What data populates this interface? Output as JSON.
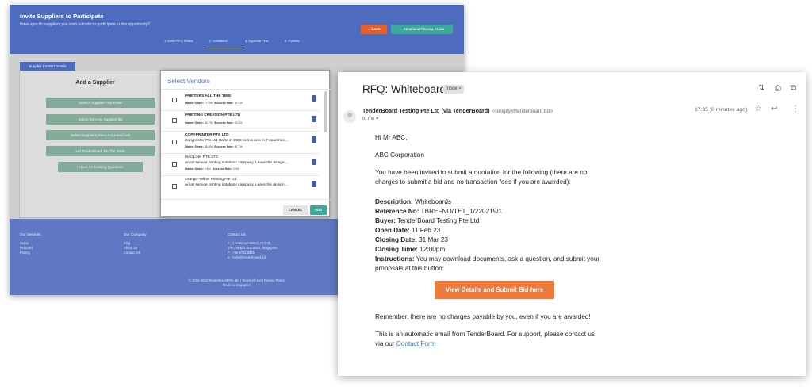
{
  "app": {
    "title": "Invite Suppliers to Participate",
    "subtitle": "Have specific suppliers you wish to invite to participate in this opportunity?",
    "back_label": "← BACK",
    "review_label": "→ REVIEW APPROVAL FLOW",
    "steps": [
      "1. Enter RFQ Details",
      "2. Invitations",
      "3. Approval Flow",
      "4. Preview"
    ],
    "supplier_tab": "Supplier Contact Details",
    "panel_title": "Add a Supplier",
    "actions": [
      "Invite A Supplier You Know",
      "Select from my Supplier list",
      "Select Suppliers From A Curated List",
      "Let TenderBoard Do The Work",
      "I Have An Existing Quotation"
    ],
    "footer": {
      "services_title": "Our Services",
      "services": [
        "Home",
        "Features",
        "Pricing"
      ],
      "company_title": "Our Company",
      "company": [
        "Blog",
        "About Us",
        "Contact Us"
      ],
      "contact_title": "Contact Us",
      "contact": [
        "A : 1 Common Street, #10-08,",
        "The Adelphi, S179803, Singapore",
        "P : +65 6711 6665",
        "E : hello@tenderboard.biz"
      ],
      "copyright": "© 2014-2022 TenderBoard Pte Ltd  |  Terms of Use  |  Privacy Policy",
      "made_in": "Made in Singapore"
    }
  },
  "modal": {
    "title": "Select Vendors",
    "cancel_label": "CANCEL",
    "add_label": "ADD",
    "vendors": [
      {
        "name": "PRINTERS ALL THE TIME",
        "desc": "",
        "market_share": "17.6%",
        "success_rate": "17.5%"
      },
      {
        "name": "PRINTING CREATION PTE LTD",
        "desc": "",
        "market_share": "32.7%",
        "success_rate": "33.2%"
      },
      {
        "name": "COPYPRINTER PTE LTD",
        "desc": "Copyprinter Pte Ltd starte in 2002 and is now in 7 countries ...",
        "market_share": "36.8%",
        "success_rate": "67.7%"
      },
      {
        "name": "MACLINK PTE LTD",
        "desc": "An all service printing solutions company. Leave the design ...",
        "market_share": "9.6%",
        "success_rate": "2.6%"
      },
      {
        "name": "Orange-Yellow Printing Pte Ltd",
        "desc": "An all service printing solutions company. Leave the design ...",
        "market_share": "",
        "success_rate": ""
      }
    ],
    "market_share_label": "Market Share:",
    "success_rate_label": "Success Rate:"
  },
  "email": {
    "subject": "RFQ: Whiteboards",
    "folder_chip": "Inbox ×",
    "sender_name": "TenderBoard Testing Pte Ltd (via TenderBoard)",
    "sender_email": "<noreply@tenderboard.biz>",
    "to": "to me ▾",
    "time": "17:35 (0 minutes ago)",
    "greeting": "Hi Mr ABC,",
    "company": "ABC Corporation",
    "intro_1": "You have been invited to submit a quotation for the following (there are no",
    "intro_2": "charges to submit a bid and no transaction fees if you are awarded):",
    "fields": [
      {
        "label": "Description",
        "value": "Whiteboards"
      },
      {
        "label": "Reference No",
        "value": "TBREFNO/TET_1/220219/1"
      },
      {
        "label": "Buyer",
        "value": "TenderBoard Testing Pte Ltd"
      },
      {
        "label": "Open Date",
        "value": "11 Feb 23"
      },
      {
        "label": "Closing Date",
        "value": "31 Mar 23"
      },
      {
        "label": "Closing Time",
        "value": "12:00pm"
      }
    ],
    "instructions_label": "Instructions",
    "instructions_1": "You may download documents, ask a question, and submit your",
    "instructions_2": "proposals at this button:",
    "cta_label": "View Details and Submit Bid here",
    "remember": "Remember, there are no charges payable by you, even if you are awarded!",
    "auto_1": "This is an automatic email from TenderBoard. For support, please contact us",
    "auto_2_prefix": "via our ",
    "contact_link": "Contact Form"
  },
  "colors": {
    "brand_blue": "#4d6cc0",
    "teal": "#3aa89a",
    "orange": "#e8612c",
    "cta_orange": "#ee7a3c",
    "green_button": "#84aa9a"
  }
}
